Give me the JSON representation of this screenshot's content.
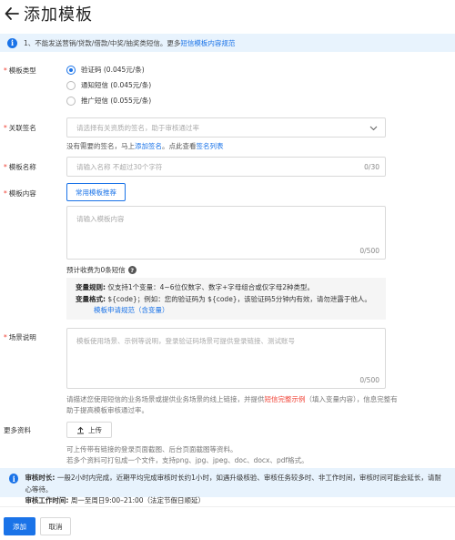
{
  "header": {
    "title": "添加模板"
  },
  "notice": {
    "text": "1、不能发送营销/贷款/借款/中奖/抽奖类短信。更多",
    "link": "短信模板内容规范"
  },
  "form": {
    "type": {
      "label": "模板类型",
      "options": [
        {
          "label": "验证码 (0.045元/条)",
          "checked": true
        },
        {
          "label": "通知短信 (0.045元/条)",
          "checked": false
        },
        {
          "label": "推广短信 (0.055元/条)",
          "checked": false
        }
      ]
    },
    "signature": {
      "label": "关联签名",
      "placeholder": "请选择有关资质的签名，助于审核通过率",
      "helper_prefix": "没有需要的签名，马上",
      "helper_link1": "添加签名",
      "helper_mid": "。点此查看",
      "helper_link2": "签名列表"
    },
    "name": {
      "label": "模板名称",
      "placeholder": "请输入名称 不超过30个字符",
      "counter": "0/30"
    },
    "content": {
      "label": "模板内容",
      "recommend_button": "常用模板推荐",
      "placeholder": "请输入模板内容",
      "counter": "0/500",
      "charge_text": "预计收费为0条短信",
      "var_rule_label": "变量规则:",
      "var_rule_text": "仅支持1个变量：4~6位仅数字、数字+字母组合或仅字母2种类型。",
      "var_format_label": "变量格式:",
      "var_format_text": "${code}；例如：您的验证码为 ${code}，该验证码5分钟内有效，请勿泄露于他人。",
      "var_link": "模板申请规范（含变量）"
    },
    "scene": {
      "label": "场景说明",
      "placeholder": "模板使用场景、示例等说明，登录验证码场景可提供登录链接、测试账号",
      "counter": "0/500",
      "hint_prefix": "请描述您使用短信的业务场景或提供业务场景的线上链接，并提供",
      "hint_link": "短信完整示例",
      "hint_suffix": "（填入变量内容），信息完整有助于提高模板审核通过率。"
    },
    "more": {
      "label": "更多资料",
      "upload_button": "上传",
      "hint_line1": "可上传带有链接的登录页面截图、后台页面截图等资料。",
      "hint_line2": "若多个资料可打包成一个文件，支持png、jpg、jpeg、doc、docx、pdf格式。"
    }
  },
  "audit": {
    "line1_label": "审核时长:",
    "line1_text": "一般2小时内完成，近期平均完成审核时长约1小时，如遇升级核验、审核任务较多时、非工作时间，审核时间可能会延长，请耐心等待。",
    "line2_label": "审核工作时间:",
    "line2_text": "周一至周日9:00–21:00（法定节假日顺延）"
  },
  "footer": {
    "submit": "添加",
    "cancel": "取消"
  },
  "colors": {
    "primary": "#1a73e8",
    "required": "#f04134",
    "notice_bg": "#e8f3fd"
  }
}
